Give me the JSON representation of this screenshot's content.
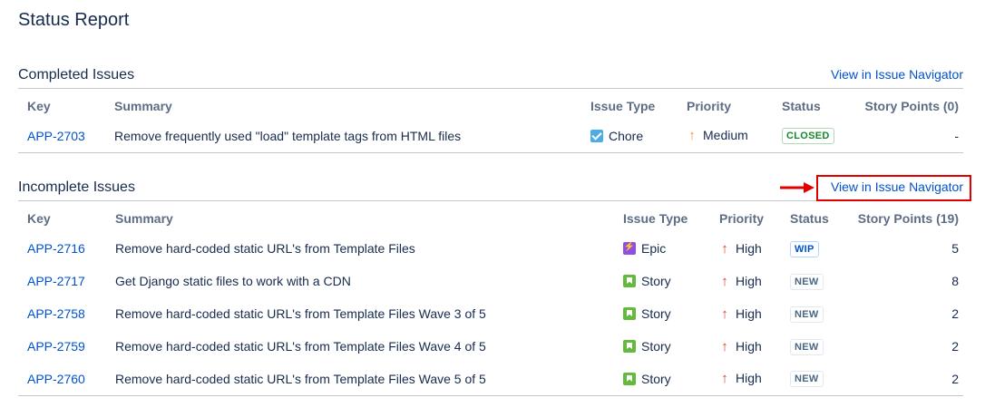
{
  "page": {
    "title": "Status Report"
  },
  "completed": {
    "title": "Completed Issues",
    "nav_link": "View in Issue Navigator",
    "columns": {
      "key": "Key",
      "summary": "Summary",
      "type": "Issue Type",
      "priority": "Priority",
      "status": "Status",
      "points": "Story Points (0)"
    },
    "rows": [
      {
        "key": "APP-2703",
        "summary": "Remove frequently used \"load\" template tags from HTML files",
        "type": "Chore",
        "type_icon": "chore-icon",
        "priority": "Medium",
        "priority_icon": "arrow-up-icon",
        "status": "CLOSED",
        "points": "-"
      }
    ]
  },
  "incomplete": {
    "title": "Incomplete Issues",
    "nav_link": "View in Issue Navigator",
    "columns": {
      "key": "Key",
      "summary": "Summary",
      "type": "Issue Type",
      "priority": "Priority",
      "status": "Status",
      "points": "Story Points (19)"
    },
    "rows": [
      {
        "key": "APP-2716",
        "summary": "Remove hard-coded static URL's from Template Files",
        "type": "Epic",
        "type_icon": "epic-icon",
        "priority": "High",
        "priority_icon": "arrow-up-icon",
        "status": "WIP",
        "points": "5"
      },
      {
        "key": "APP-2717",
        "summary": "Get Django static files to work with a CDN",
        "type": "Story",
        "type_icon": "story-icon",
        "priority": "High",
        "priority_icon": "arrow-up-icon",
        "status": "NEW",
        "points": "8"
      },
      {
        "key": "APP-2758",
        "summary": "Remove hard-coded static URL's from Template Files Wave 3 of 5",
        "type": "Story",
        "type_icon": "story-icon",
        "priority": "High",
        "priority_icon": "arrow-up-icon",
        "status": "NEW",
        "points": "2"
      },
      {
        "key": "APP-2759",
        "summary": "Remove hard-coded static URL's from Template Files Wave 4 of 5",
        "type": "Story",
        "type_icon": "story-icon",
        "priority": "High",
        "priority_icon": "arrow-up-icon",
        "status": "NEW",
        "points": "2"
      },
      {
        "key": "APP-2760",
        "summary": "Remove hard-coded static URL's from Template Files Wave 5 of 5",
        "type": "Story",
        "type_icon": "story-icon",
        "priority": "High",
        "priority_icon": "arrow-up-icon",
        "status": "NEW",
        "points": "2"
      }
    ]
  },
  "colors": {
    "link": "#0052cc",
    "text": "#172b4d",
    "header_text": "#5e6c84",
    "annotation": "#e00000",
    "priority_high": "#d04437",
    "priority_medium": "#f79232"
  }
}
